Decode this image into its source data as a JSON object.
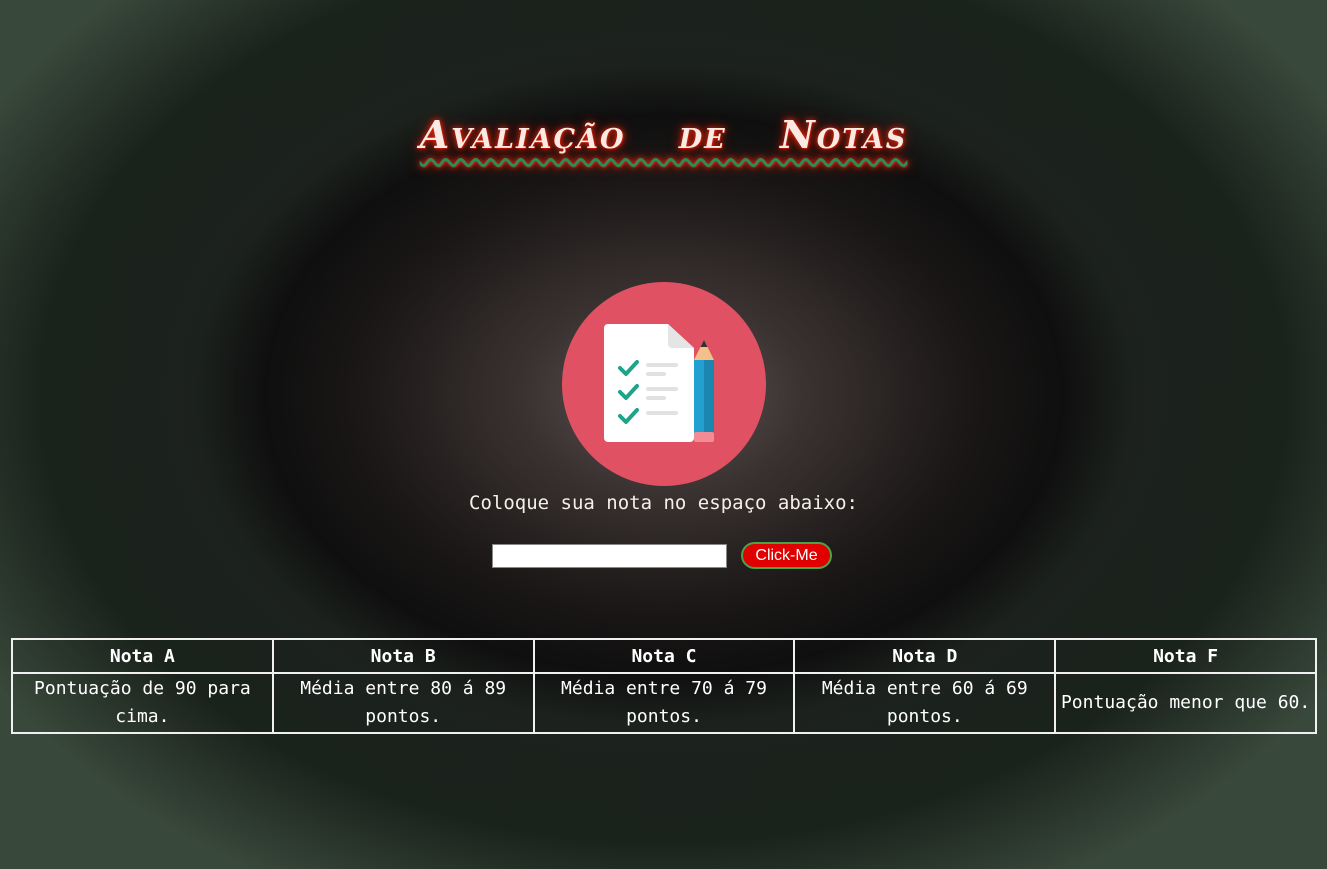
{
  "header": {
    "title": "Avaliação de Notas"
  },
  "logo": {
    "icon": "checklist-pencil-icon",
    "circle_color": "#e05263",
    "check_color": "#1fa38a"
  },
  "form": {
    "prompt": "Coloque sua nota no espaço abaixo:",
    "input_value": "",
    "button_label": "Click-Me"
  },
  "grades_table": {
    "headers": [
      "Nota A",
      "Nota B",
      "Nota C",
      "Nota D",
      "Nota F"
    ],
    "descriptions": [
      "Pontuação de 90 para cima.",
      "Média entre 80 á 89 pontos.",
      "Média entre 70 á 79 pontos.",
      "Média entre 60 á 69 pontos.",
      "Pontuação menor que 60."
    ]
  }
}
